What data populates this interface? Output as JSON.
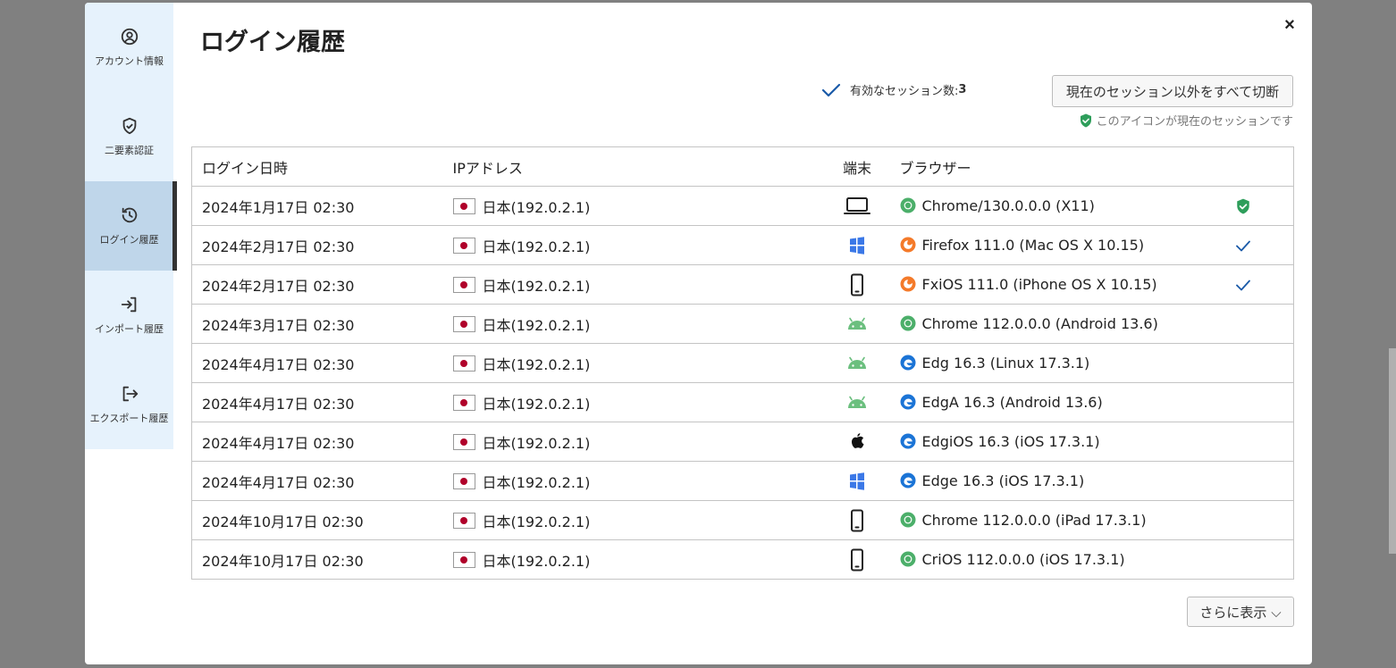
{
  "sidebar": {
    "items": [
      {
        "label": "アカウント情報",
        "icon": "user-circle-icon"
      },
      {
        "label": "二要素認証",
        "icon": "shield-check-icon"
      },
      {
        "label": "ログイン履歴",
        "icon": "history-icon",
        "active": true
      },
      {
        "label": "インポート履歴",
        "icon": "import-icon"
      },
      {
        "label": "エクスポート履歴",
        "icon": "export-icon"
      }
    ]
  },
  "header": {
    "title": "ログイン履歴",
    "close_label": "×"
  },
  "sessions": {
    "label": "有効なセッション数:",
    "count": "3",
    "disconnect_label": "現在のセッション以外をすべて切断",
    "current_note": "このアイコンが現在のセッションです"
  },
  "table": {
    "headers": {
      "date": "ログイン日時",
      "ip": "IPアドレス",
      "device": "端末",
      "browser": "ブラウザー"
    },
    "rows": [
      {
        "date": "2024年1月17日 02:30",
        "ip": "日本(192.0.2.1)",
        "device": "laptop-icon",
        "browser_icon": "chrome-icon",
        "browser": "Chrome/130.0.0.0 (X11)",
        "status": "current"
      },
      {
        "date": "2024年2月17日 02:30",
        "ip": "日本(192.0.2.1)",
        "device": "windows-icon",
        "browser_icon": "firefox-icon",
        "browser": "Firefox 111.0 (Mac OS X 10.15)",
        "status": "active"
      },
      {
        "date": "2024年2月17日 02:30",
        "ip": "日本(192.0.2.1)",
        "device": "phone-icon",
        "browser_icon": "firefox-icon",
        "browser": "FxiOS 111.0 (iPhone OS X 10.15)",
        "status": "active"
      },
      {
        "date": "2024年3月17日 02:30",
        "ip": "日本(192.0.2.1)",
        "device": "android-icon",
        "browser_icon": "chrome-icon",
        "browser": "Chrome 112.0.0.0 (Android 13.6)",
        "status": ""
      },
      {
        "date": "2024年4月17日 02:30",
        "ip": "日本(192.0.2.1)",
        "device": "android-icon",
        "browser_icon": "edge-icon",
        "browser": "Edg 16.3 (Linux 17.3.1)",
        "status": ""
      },
      {
        "date": "2024年4月17日 02:30",
        "ip": "日本(192.0.2.1)",
        "device": "android-icon",
        "browser_icon": "edge-icon",
        "browser": "EdgA 16.3 (Android 13.6)",
        "status": ""
      },
      {
        "date": "2024年4月17日 02:30",
        "ip": "日本(192.0.2.1)",
        "device": "apple-icon",
        "browser_icon": "edge-icon",
        "browser": "EdgiOS 16.3 (iOS 17.3.1)",
        "status": ""
      },
      {
        "date": "2024年4月17日 02:30",
        "ip": "日本(192.0.2.1)",
        "device": "windows-icon",
        "browser_icon": "edge-icon",
        "browser": "Edge 16.3 (iOS 17.3.1)",
        "status": ""
      },
      {
        "date": "2024年10月17日 02:30",
        "ip": "日本(192.0.2.1)",
        "device": "phone-icon",
        "browser_icon": "chrome-icon",
        "browser": "Chrome 112.0.0.0 (iPad 17.3.1)",
        "status": ""
      },
      {
        "date": "2024年10月17日 02:30",
        "ip": "日本(192.0.2.1)",
        "device": "phone-icon",
        "browser_icon": "chrome-icon",
        "browser": "CriOS 112.0.0.0 (iOS 17.3.1)",
        "status": ""
      }
    ]
  },
  "more_label": "さらに表示 ⌵",
  "colors": {
    "accent_blue": "#1a5aa8",
    "current_green": "#2e9e5b",
    "sidebar_bg": "#e6f2fc",
    "sidebar_active": "#bfd6ea"
  }
}
